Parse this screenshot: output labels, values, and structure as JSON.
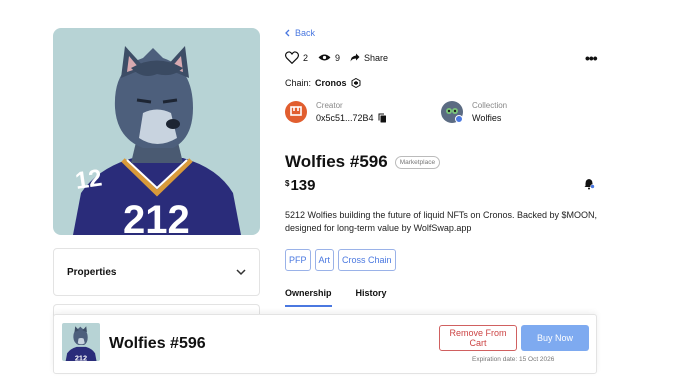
{
  "nav": {
    "back_label": "Back"
  },
  "stats": {
    "likes": "2",
    "views": "9",
    "share_label": "Share"
  },
  "chain": {
    "label": "Chain:",
    "name": "Cronos"
  },
  "creator": {
    "caption": "Creator",
    "address": "0x5c51...72B4"
  },
  "collection": {
    "caption": "Collection",
    "name": "Wolfies"
  },
  "item": {
    "title": "Wolfies #596",
    "badge": "Marketplace",
    "price_currency": "$",
    "price_value": "139",
    "description": "5212 Wolfies building the future of liquid NFTs on Cronos. Backed by $MOON, designed for long-term value by WolfSwap.app",
    "tags": [
      "PFP",
      "Art",
      "Cross Chain"
    ]
  },
  "properties": {
    "label": "Properties"
  },
  "tabs": {
    "ownership": "Ownership",
    "history": "History"
  },
  "bottom_bar": {
    "title": "Wolfies #596",
    "remove_label": "Remove From Cart",
    "buy_label": "Buy Now",
    "expiry": "Expiration date: 15 Oct 2026"
  },
  "colors": {
    "accent": "#4a78e0",
    "remove": "#cc4444",
    "buy": "#7eaaf0",
    "image_bg": "#b7d3d5"
  },
  "icons": [
    "heart-icon",
    "eye-icon",
    "share-icon",
    "more-icon",
    "cronos-icon",
    "copy-icon",
    "bell-icon",
    "chevron-down-icon",
    "chevron-left-icon"
  ]
}
